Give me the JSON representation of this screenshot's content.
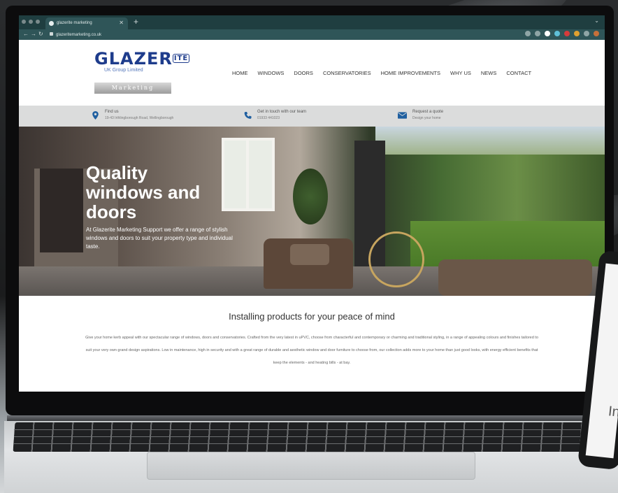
{
  "browser": {
    "tab_title": "glazerite marketing",
    "url": "glazeritemarketing.co.uk"
  },
  "logo": {
    "main": "GLAZER",
    "suffix": "ITE",
    "subtitle": "UK Group Limited",
    "badge": "Marketing Support"
  },
  "nav": {
    "items": [
      "HOME",
      "WINDOWS",
      "DOORS",
      "CONSERVATORIES",
      "HOME IMPROVEMENTS",
      "WHY US",
      "NEWS",
      "CONTACT"
    ]
  },
  "infobar": {
    "find_us": {
      "title": "Find us",
      "sub": "19-43 Irthlingborough Road, Wellingborough"
    },
    "get_in_touch": {
      "title": "Get in touch with our team",
      "sub": "01933 441023"
    },
    "quote": {
      "title": "Request a quote",
      "sub": "Design your home"
    }
  },
  "hero": {
    "title_line1": "Quality",
    "title_line2": "windows and",
    "title_line3": "doors",
    "body": "At Glazerite Marketing Support we offer a range of stylish windows and doors to suit your property type and individual taste."
  },
  "intro": {
    "title": "Installing products for your peace of mind",
    "body": "Give your home kerb appeal with our spectacular range of windows, doors and conservatories. Crafted from the very latest in uPVC, choose from characterful and contemporary or charming and traditional styling, in a range of appealing colours and finishes tailored to suit your very own grand design aspirations. Low in maintenance, high in security and with a great range of durable and aesthetic window and door furniture to choose from, our collection adds more to your home than just good looks, with energy efficient benefits that keep the elements - and heating bills - at bay."
  },
  "phone": {
    "visible_text": "In"
  },
  "colors": {
    "brand_blue": "#1e3c8c",
    "browser_chrome": "#1f3e40",
    "infobar": "#dbdcdc",
    "icon_blue": "#1f5fa0"
  }
}
